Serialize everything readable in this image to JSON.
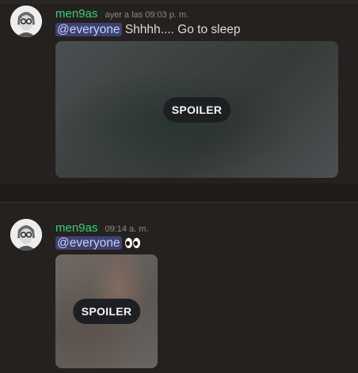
{
  "messages": [
    {
      "username": "men9as",
      "timestamp": "ayer a las 09:03 p. m.",
      "mention": "@everyone",
      "text": "Shhhh.... Go to sleep",
      "attachment_label": "SPOILER"
    },
    {
      "username": "men9as",
      "timestamp": "09:14 a. m.",
      "mention": "@everyone",
      "emoji": "eyes",
      "attachment_label": "SPOILER"
    }
  ],
  "colors": {
    "background": "#25211e",
    "username": "#33d17a",
    "mention_bg": "#3c4270",
    "mention_text": "#c9cdfb",
    "spoiler_pill": "#1e1f22"
  }
}
